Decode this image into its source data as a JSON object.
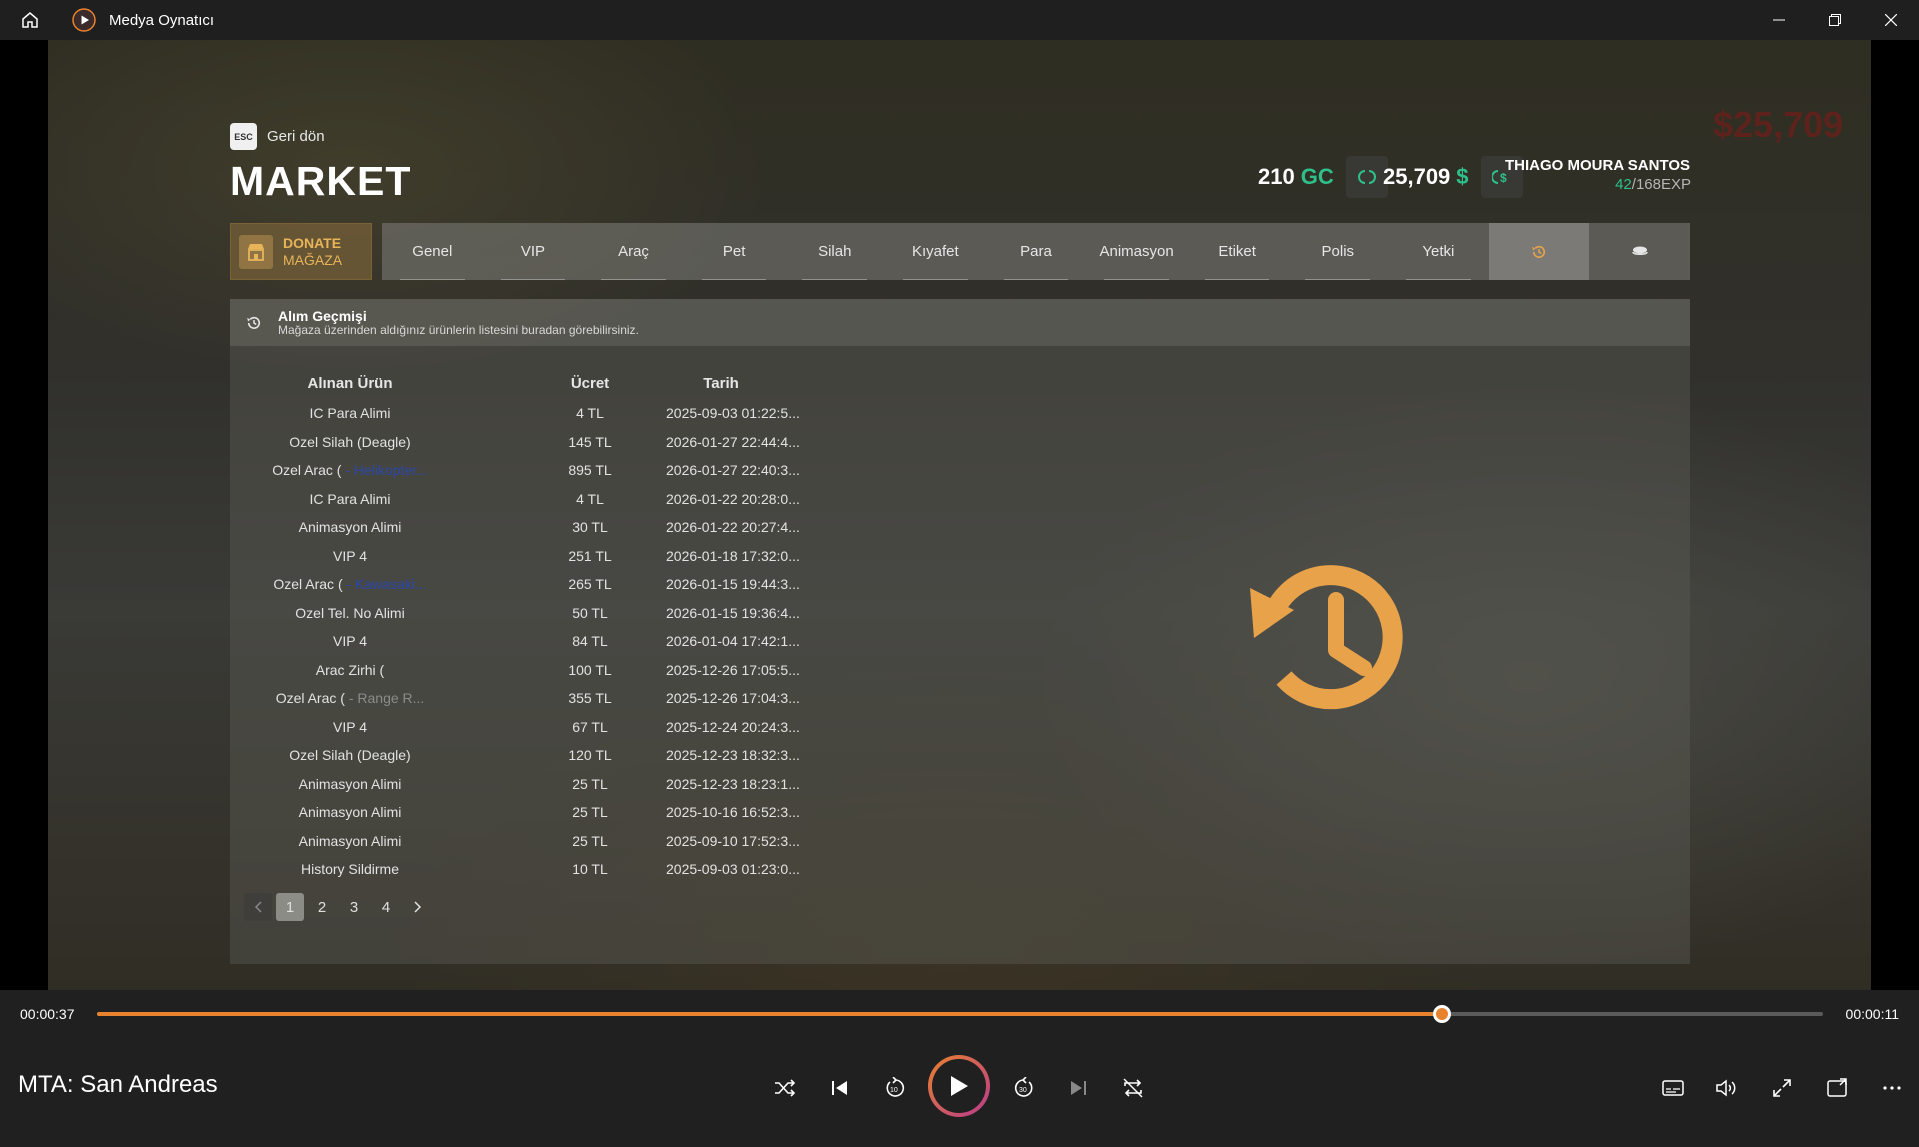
{
  "window": {
    "title": "Medya Oynatıcı"
  },
  "market": {
    "back_key": "ESC",
    "back_label": "Geri dön",
    "title": "MARKET",
    "gc_amount": "210",
    "gc_unit": "GC",
    "money_amount": "25,709",
    "money_unit": "$",
    "player_name": "THIAGO MOURA SANTOS",
    "player_level": "42",
    "player_exp": "/168EXP",
    "bg_money": "$25,709",
    "donate_line1": "DONATE",
    "donate_line2": "MAĞAZA",
    "tabs": [
      "Genel",
      "VIP",
      "Araç",
      "Pet",
      "Silah",
      "Kıyafet",
      "Para",
      "Animasyon",
      "Etiket",
      "Polis",
      "Yetki"
    ],
    "active_tab": "history",
    "panel_title": "Alım Geçmişi",
    "panel_subtitle": "Mağaza üzerinden aldığınız ürünlerin listesini buradan görebilirsiniz.",
    "columns": [
      "Alınan Ürün",
      "Ücret",
      "Tarih"
    ],
    "rows": [
      {
        "item": "IC Para Alimi",
        "extra": "",
        "price": "4 TL",
        "date": "2025-09-03 01:22:5..."
      },
      {
        "item": "Ozel Silah (Deagle)",
        "extra": "",
        "price": "145 TL",
        "date": "2026-01-27 22:44:4..."
      },
      {
        "item": "Ozel Arac (",
        "extra": "- Helikopter...",
        "price": "895 TL",
        "date": "2026-01-27 22:40:3..."
      },
      {
        "item": "IC Para Alimi",
        "extra": "",
        "price": "4 TL",
        "date": "2026-01-22 20:28:0..."
      },
      {
        "item": "Animasyon Alimi",
        "extra": "",
        "price": "30 TL",
        "date": "2026-01-22 20:27:4..."
      },
      {
        "item": "VIP 4",
        "extra": "",
        "price": "251 TL",
        "date": "2026-01-18 17:32:0..."
      },
      {
        "item": "Ozel Arac (",
        "extra": "- Kawasaki...",
        "price": "265 TL",
        "date": "2026-01-15 19:44:3..."
      },
      {
        "item": "Ozel Tel. No Alimi",
        "extra": "",
        "price": "50 TL",
        "date": "2026-01-15 19:36:4..."
      },
      {
        "item": "VIP 4",
        "extra": "",
        "price": "84 TL",
        "date": "2026-01-04 17:42:1..."
      },
      {
        "item": "Arac Zirhi (",
        "extra": "",
        "price": "100 TL",
        "date": "2025-12-26 17:05:5..."
      },
      {
        "item": "Ozel Arac (",
        "extra": "- Range R...",
        "price": "355 TL",
        "date": "2025-12-26 17:04:3..."
      },
      {
        "item": "VIP 4",
        "extra": "",
        "price": "67 TL",
        "date": "2025-12-24 20:24:3..."
      },
      {
        "item": "Ozel Silah (Deagle)",
        "extra": "",
        "price": "120 TL",
        "date": "2025-12-23 18:32:3..."
      },
      {
        "item": "Animasyon Alimi",
        "extra": "",
        "price": "25 TL",
        "date": "2025-12-23 18:23:1..."
      },
      {
        "item": "Animasyon Alimi",
        "extra": "",
        "price": "25 TL",
        "date": "2025-10-16 16:52:3..."
      },
      {
        "item": "Animasyon Alimi",
        "extra": "",
        "price": "25 TL",
        "date": "2025-09-10 17:52:3..."
      },
      {
        "item": "History Sildirme",
        "extra": "",
        "price": "10 TL",
        "date": "2025-09-03 01:23:0..."
      }
    ],
    "pages": [
      "1",
      "2",
      "3",
      "4"
    ],
    "current_page": "1"
  },
  "player": {
    "elapsed": "00:00:37",
    "remaining": "00:00:11",
    "progress": 0.779,
    "media_title": "MTA: San Andreas"
  },
  "colors": {
    "accent": "#e8822f",
    "gc_green": "#2ec08a",
    "history_orange": "#e8a24a"
  },
  "icons": [
    "home-icon",
    "app-icon",
    "minimize-icon",
    "restore-icon",
    "close-icon",
    "shop-icon",
    "history-icon",
    "coin-icon",
    "shuffle-icon",
    "previous-icon",
    "rewind-10-icon",
    "play-icon",
    "forward-30-icon",
    "next-icon",
    "repeat-icon",
    "subtitles-icon",
    "volume-icon",
    "fullscreen-icon",
    "miniplayer-icon",
    "more-icon"
  ]
}
